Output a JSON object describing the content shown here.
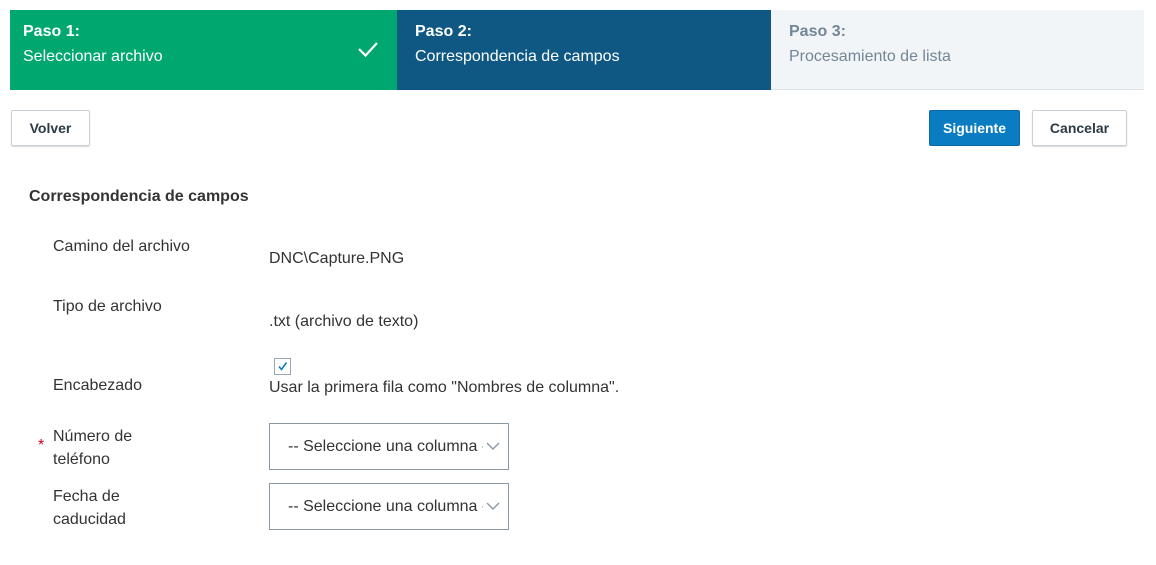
{
  "steps": [
    {
      "num": "Paso 1:",
      "name": "Seleccionar archivo",
      "state": "completed"
    },
    {
      "num": "Paso 2:",
      "name": "Correspondencia de campos",
      "state": "active"
    },
    {
      "num": "Paso 3:",
      "name": "Procesamiento de lista",
      "state": "pending"
    }
  ],
  "buttons": {
    "back": "Volver",
    "next": "Siguiente",
    "cancel": "Cancelar"
  },
  "section": {
    "title": "Correspondencia de campos"
  },
  "fields": {
    "path": {
      "label": "Camino del archivo",
      "value": "DNC\\Capture.PNG"
    },
    "type": {
      "label": "Tipo de archivo",
      "value": ".txt (archivo de texto)"
    },
    "header": {
      "label": "Encabezado",
      "checked": true,
      "option": "Usar la primera fila como \"Nombres de columna\"."
    },
    "phone": {
      "label": "Número de teléfono",
      "required_mark": "*",
      "select_value": "-- Seleccione una columna --"
    },
    "expiry": {
      "label": "Fecha de caducidad",
      "select_value": "-- Seleccione una columna --"
    }
  },
  "colors": {
    "completed": "#00a870",
    "active": "#0e5883",
    "pending": "#f1f5f8",
    "primary": "#0a7cc1",
    "required": "#d0021b"
  },
  "icons": {
    "completed": "check-icon",
    "select": "chevron-down-icon",
    "checkbox": "checkmark-icon"
  }
}
